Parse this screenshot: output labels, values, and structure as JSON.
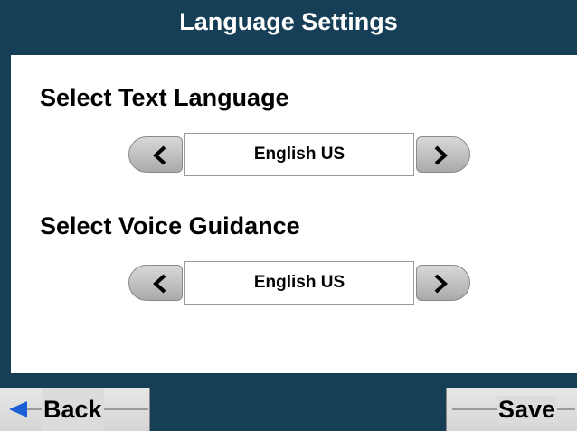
{
  "header": {
    "title": "Language Settings"
  },
  "text_language": {
    "label": "Select Text Language",
    "value": "English US",
    "prev_icon": "chevron-left-icon",
    "next_icon": "chevron-right-icon"
  },
  "voice_guidance": {
    "label": "Select Voice Guidance",
    "value": "English US",
    "prev_icon": "chevron-left-icon",
    "next_icon": "chevron-right-icon"
  },
  "footer": {
    "back_label": "Back",
    "back_icon": "back-arrow-icon",
    "save_label": "Save"
  },
  "colors": {
    "frame": "#163e57",
    "content_background": "#ffffff",
    "back_arrow": "#1a5fd6"
  }
}
